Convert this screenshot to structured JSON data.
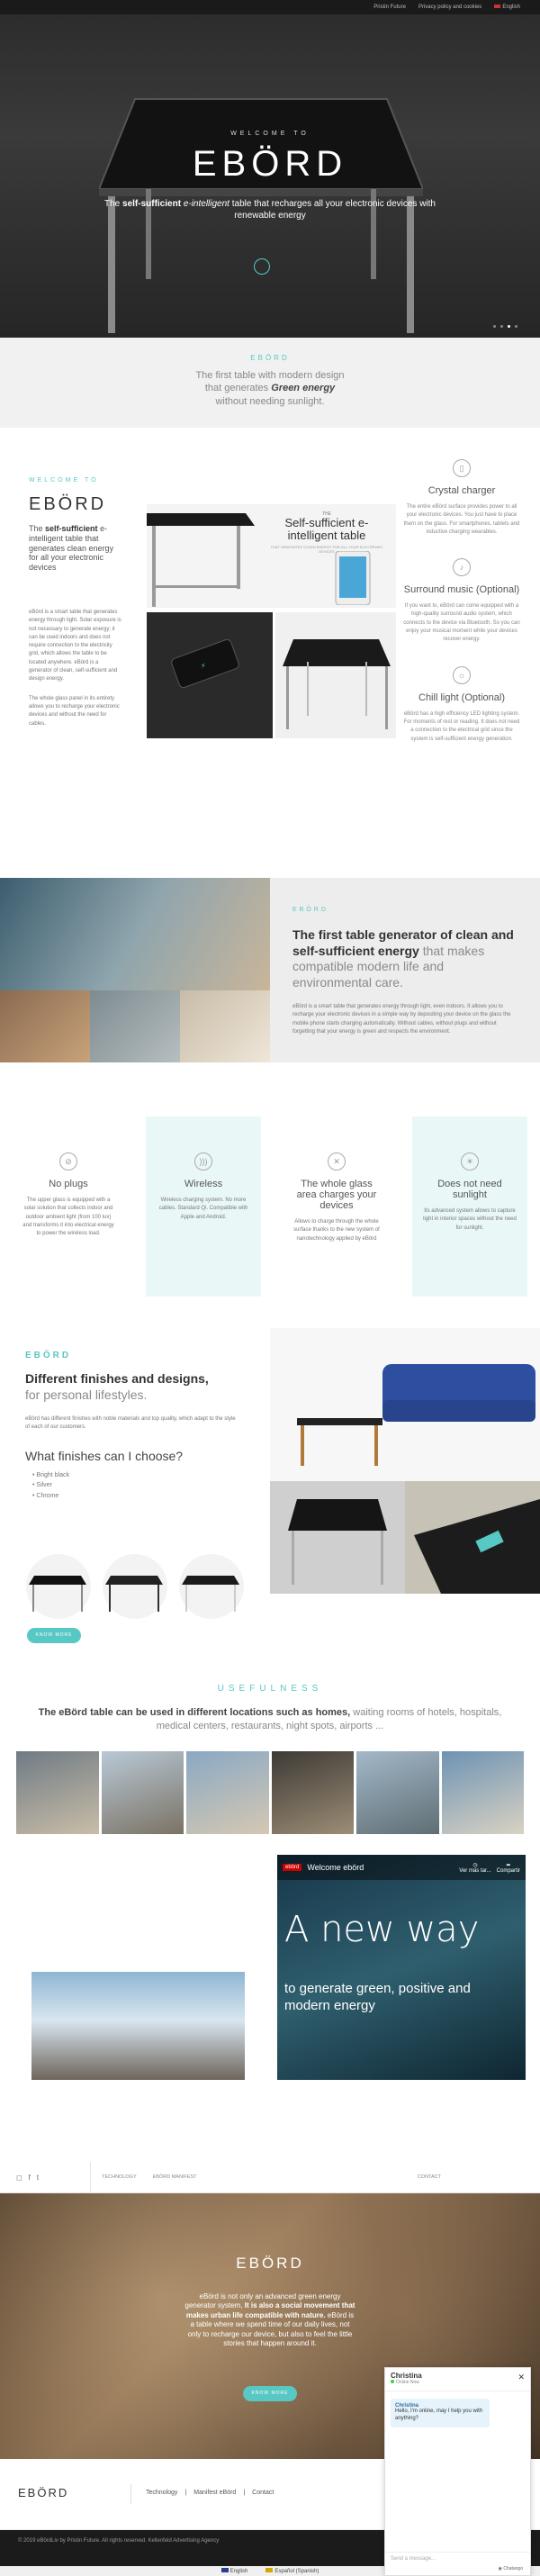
{
  "topbar": {
    "links": [
      "Pristin Future",
      "Privacy policy and cookies",
      "English"
    ]
  },
  "hero": {
    "welcome": "WELCOME TO",
    "logo": "EBÖRD",
    "tag_bold": "self-sufficient",
    "tag_italic": "e-intelligent",
    "tag_pre": "The",
    "tag_rest": "table that recharges all your electronic devices with renewable energy"
  },
  "intro": {
    "eyebrow": "EBÖRD",
    "line1": "The first table with modern design",
    "line2": "that generates",
    "line2_em": "Green energy",
    "line3": "without needing sunlight."
  },
  "about": {
    "eyebrow": "WELCOME TO",
    "logo": "EBÖRD",
    "lead_pre": "The",
    "lead_bold": "self-sufficient",
    "lead_rest": "e-intelligent table that generates clean energy for all your electronic devices",
    "p1": "eBörd is a smart table that generates energy through light. Solar exposure is not necessary to generate energy; it can be used indoors and does not require connection to the electricity grid, which allows the table to be located anywhere. eBörd is a generator of clean, self-sufficient and design energy.",
    "p2": "The whole glass panel in its entirety allows you to recharge your electronic devices and without the need for cables.",
    "banner_small": "THE",
    "banner_title": "Self-sufficient e-intelligent table",
    "banner_sub": "THAT GENERATES CLEAN ENERGY FOR ALL YOUR ELECTRONIC DEVICES"
  },
  "features": [
    {
      "icon": "phone-charger-icon",
      "title": "Crystal charger",
      "text": "The entire eBörd surface provides power to all your electronic devices. You just have to place them on the glass. For smartphones, tablets and inductive charging wearables."
    },
    {
      "icon": "speaker-icon",
      "title": "Surround music (Optional)",
      "text": "If you want to, eBörd can come equipped with a high-quality surround audio system, which connects to the device via Bluetooth. So you can enjoy your musical moment while your devices recover energy."
    },
    {
      "icon": "bulb-icon",
      "title": "Chill light (Optional)",
      "text": "eBörd has a high efficiency LED lighting system. For moments of rest or reading. It does not need a connection to the electrical grid since the system is self-sufficient energy generation."
    }
  ],
  "generator": {
    "eyebrow": "EBÖRD",
    "title_bold": "The first table generator of clean and self-sufficient energy",
    "title_rest": "that makes compatible modern life and environmental care.",
    "text": "eBörd is a smart table that generates energy through light, even indoors. It allows you to recharge your electronic devices in a simple way by depositing your device on the glass the mobile phone starts charging automatically. Without cables, without plugs and without forgetting that your energy is green and respects the environment."
  },
  "cards": [
    {
      "icon": "no-plug-icon",
      "title": "No plugs",
      "text": "The upper glass is equipped with a solar solution that collects indoor and outdoor ambient light (from 100 lux) and transforms it into electrical energy to power the wireless load."
    },
    {
      "icon": "wireless-icon",
      "title": "Wireless",
      "text": "Wireless charging system. No more cables. Standard Qi. Compatible with Apple and Android."
    },
    {
      "icon": "glass-area-icon",
      "title": "The whole glass area charges your devices",
      "text": "Allows to charge through the whole surface thanks to the new system of nanotechnology applied by eBörd"
    },
    {
      "icon": "sunlight-icon",
      "title": "Does not need sunlight",
      "text": "Its advanced system allows to capture light in interior spaces without the need for sunlight."
    }
  ],
  "finishes": {
    "eyebrow": "EBÖRD",
    "title_bold": "Different finishes and designs,",
    "title_rest": "for personal lifestyles.",
    "text": "eBörd has different finishes with noble materials and top quality, which adapt to the style of each of our customers.",
    "question": "What finishes can I choose?",
    "options": [
      "Bright black",
      "Silver",
      "Chrome"
    ],
    "button": "KNOW MORE"
  },
  "usefulness": {
    "eyebrow": "USEFULNESS",
    "text_bold": "The eBörd table can be used in different locations such as homes,",
    "text_rest": "waiting rooms of hotels, hospitals, medical centers, restaurants, night spots, airports ..."
  },
  "video": {
    "channel": "ebörd",
    "title": "Welcome ebörd",
    "watch": "Ver más tar...",
    "share": "Compartir",
    "big": "A new way",
    "sub": "to generate green, positive and modern energy"
  },
  "footer_nav": {
    "links": [
      "TECHNOLOGY",
      "EBÖRD MANIFEST",
      "CONTACT"
    ],
    "social": [
      "instagram-icon",
      "facebook-icon",
      "twitter-icon"
    ]
  },
  "promo": {
    "logo": "EBÖRD",
    "text_pre": "eBörd is not only an advanced green energy generator system,",
    "text_bold": "It is also a social movement that makes urban life compatible with nature.",
    "text_rest": "eBörd is a table where we spend time of our daily lives, not only to recharge our device, but also to feel the little stories that happen around it.",
    "button": "KNOW MORE"
  },
  "footer": {
    "logo": "EBÖRD",
    "links": [
      "Technology",
      "Manifest eBörd",
      "Contact"
    ],
    "copyright": "© 2019 eBördLiv by Pristin Future. All rights reserved. Kellenfeld Advertising Agency",
    "lang": [
      "English",
      "Español (Spanish)"
    ]
  },
  "chat": {
    "name": "Christina",
    "status": "Online Now",
    "bubble_name": "Christina",
    "bubble_text": "Hello, I'm online, may I help you with anything?",
    "placeholder": "Send a message...",
    "powered": "Chatango"
  }
}
